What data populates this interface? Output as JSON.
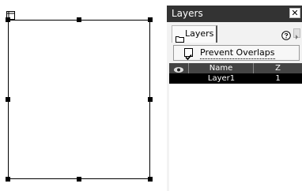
{
  "canvas": {
    "anchor_icon": "layer-anchor-icon"
  },
  "panel": {
    "title": "Layers",
    "close_icon": "close-icon",
    "close_glyph": "✕",
    "tab_label": "Layers",
    "tab_icon": "folder-icon",
    "help_icon": "help-icon",
    "menu_icon": "panel-menu-arrow-icon",
    "prevent_overlaps": {
      "label": "Prevent Overlaps",
      "checked": true
    },
    "columns": {
      "visibility_icon": "eye-icon",
      "name": "Name",
      "z": "Z"
    },
    "layers": [
      {
        "name": "Layer1",
        "z": "1",
        "selected": true
      }
    ]
  },
  "colors": {
    "title_bar": "#333333",
    "header_row": "#444444",
    "selected_row": "#000000",
    "panel_bg": "#f2f2f2"
  }
}
